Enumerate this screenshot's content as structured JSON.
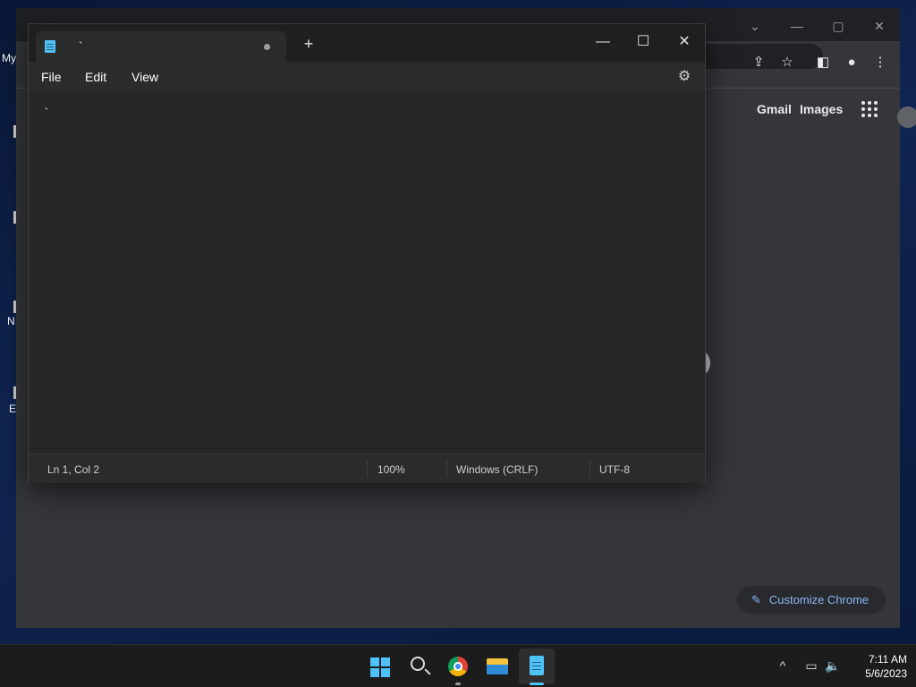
{
  "desktop": {
    "labels": [
      "My",
      "N",
      "E"
    ]
  },
  "chrome": {
    "links": {
      "gmail": "Gmail",
      "images": "Images"
    },
    "customize_label": "Customize Chrome"
  },
  "notepad": {
    "tab_title": "`",
    "menu": {
      "file": "File",
      "edit": "Edit",
      "view": "View"
    },
    "content": "`",
    "status": {
      "position": "Ln 1, Col 2",
      "zoom": "100%",
      "line_ending": "Windows (CRLF)",
      "encoding": "UTF-8"
    }
  },
  "taskbar": {
    "time": "7:11 AM",
    "date": "5/6/2023"
  },
  "colors": {
    "accent": "#4cc2ff",
    "link_blue": "#8ab4f8"
  }
}
